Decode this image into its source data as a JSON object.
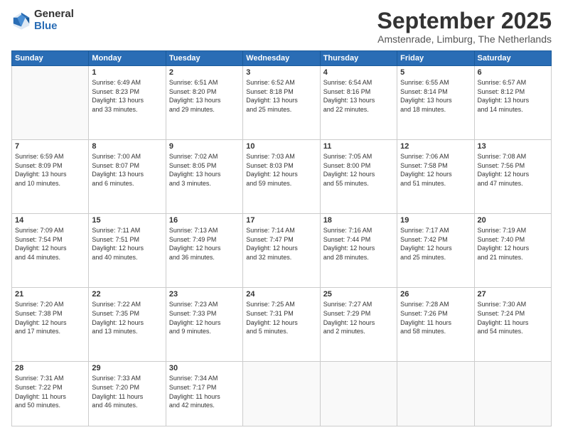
{
  "logo": {
    "general": "General",
    "blue": "Blue"
  },
  "title": "September 2025",
  "subtitle": "Amstenrade, Limburg, The Netherlands",
  "weekdays": [
    "Sunday",
    "Monday",
    "Tuesday",
    "Wednesday",
    "Thursday",
    "Friday",
    "Saturday"
  ],
  "weeks": [
    [
      {
        "day": "",
        "info": ""
      },
      {
        "day": "1",
        "info": "Sunrise: 6:49 AM\nSunset: 8:23 PM\nDaylight: 13 hours\nand 33 minutes."
      },
      {
        "day": "2",
        "info": "Sunrise: 6:51 AM\nSunset: 8:20 PM\nDaylight: 13 hours\nand 29 minutes."
      },
      {
        "day": "3",
        "info": "Sunrise: 6:52 AM\nSunset: 8:18 PM\nDaylight: 13 hours\nand 25 minutes."
      },
      {
        "day": "4",
        "info": "Sunrise: 6:54 AM\nSunset: 8:16 PM\nDaylight: 13 hours\nand 22 minutes."
      },
      {
        "day": "5",
        "info": "Sunrise: 6:55 AM\nSunset: 8:14 PM\nDaylight: 13 hours\nand 18 minutes."
      },
      {
        "day": "6",
        "info": "Sunrise: 6:57 AM\nSunset: 8:12 PM\nDaylight: 13 hours\nand 14 minutes."
      }
    ],
    [
      {
        "day": "7",
        "info": "Sunrise: 6:59 AM\nSunset: 8:09 PM\nDaylight: 13 hours\nand 10 minutes."
      },
      {
        "day": "8",
        "info": "Sunrise: 7:00 AM\nSunset: 8:07 PM\nDaylight: 13 hours\nand 6 minutes."
      },
      {
        "day": "9",
        "info": "Sunrise: 7:02 AM\nSunset: 8:05 PM\nDaylight: 13 hours\nand 3 minutes."
      },
      {
        "day": "10",
        "info": "Sunrise: 7:03 AM\nSunset: 8:03 PM\nDaylight: 12 hours\nand 59 minutes."
      },
      {
        "day": "11",
        "info": "Sunrise: 7:05 AM\nSunset: 8:00 PM\nDaylight: 12 hours\nand 55 minutes."
      },
      {
        "day": "12",
        "info": "Sunrise: 7:06 AM\nSunset: 7:58 PM\nDaylight: 12 hours\nand 51 minutes."
      },
      {
        "day": "13",
        "info": "Sunrise: 7:08 AM\nSunset: 7:56 PM\nDaylight: 12 hours\nand 47 minutes."
      }
    ],
    [
      {
        "day": "14",
        "info": "Sunrise: 7:09 AM\nSunset: 7:54 PM\nDaylight: 12 hours\nand 44 minutes."
      },
      {
        "day": "15",
        "info": "Sunrise: 7:11 AM\nSunset: 7:51 PM\nDaylight: 12 hours\nand 40 minutes."
      },
      {
        "day": "16",
        "info": "Sunrise: 7:13 AM\nSunset: 7:49 PM\nDaylight: 12 hours\nand 36 minutes."
      },
      {
        "day": "17",
        "info": "Sunrise: 7:14 AM\nSunset: 7:47 PM\nDaylight: 12 hours\nand 32 minutes."
      },
      {
        "day": "18",
        "info": "Sunrise: 7:16 AM\nSunset: 7:44 PM\nDaylight: 12 hours\nand 28 minutes."
      },
      {
        "day": "19",
        "info": "Sunrise: 7:17 AM\nSunset: 7:42 PM\nDaylight: 12 hours\nand 25 minutes."
      },
      {
        "day": "20",
        "info": "Sunrise: 7:19 AM\nSunset: 7:40 PM\nDaylight: 12 hours\nand 21 minutes."
      }
    ],
    [
      {
        "day": "21",
        "info": "Sunrise: 7:20 AM\nSunset: 7:38 PM\nDaylight: 12 hours\nand 17 minutes."
      },
      {
        "day": "22",
        "info": "Sunrise: 7:22 AM\nSunset: 7:35 PM\nDaylight: 12 hours\nand 13 minutes."
      },
      {
        "day": "23",
        "info": "Sunrise: 7:23 AM\nSunset: 7:33 PM\nDaylight: 12 hours\nand 9 minutes."
      },
      {
        "day": "24",
        "info": "Sunrise: 7:25 AM\nSunset: 7:31 PM\nDaylight: 12 hours\nand 5 minutes."
      },
      {
        "day": "25",
        "info": "Sunrise: 7:27 AM\nSunset: 7:29 PM\nDaylight: 12 hours\nand 2 minutes."
      },
      {
        "day": "26",
        "info": "Sunrise: 7:28 AM\nSunset: 7:26 PM\nDaylight: 11 hours\nand 58 minutes."
      },
      {
        "day": "27",
        "info": "Sunrise: 7:30 AM\nSunset: 7:24 PM\nDaylight: 11 hours\nand 54 minutes."
      }
    ],
    [
      {
        "day": "28",
        "info": "Sunrise: 7:31 AM\nSunset: 7:22 PM\nDaylight: 11 hours\nand 50 minutes."
      },
      {
        "day": "29",
        "info": "Sunrise: 7:33 AM\nSunset: 7:20 PM\nDaylight: 11 hours\nand 46 minutes."
      },
      {
        "day": "30",
        "info": "Sunrise: 7:34 AM\nSunset: 7:17 PM\nDaylight: 11 hours\nand 42 minutes."
      },
      {
        "day": "",
        "info": ""
      },
      {
        "day": "",
        "info": ""
      },
      {
        "day": "",
        "info": ""
      },
      {
        "day": "",
        "info": ""
      }
    ]
  ]
}
